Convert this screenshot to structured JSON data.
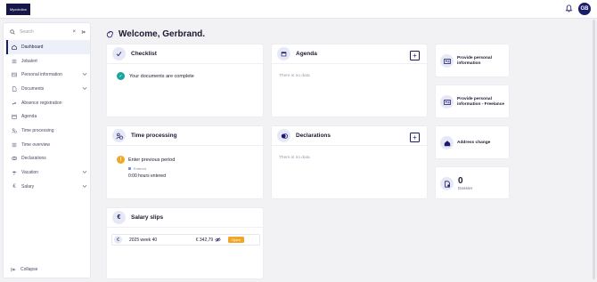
{
  "topbar": {
    "logo_text": "Myxolution",
    "avatar_initials": "GB"
  },
  "sidebar": {
    "search_placeholder": "Search",
    "items": [
      {
        "label": "Dashboard",
        "icon": "home-icon",
        "active": true
      },
      {
        "label": "Jobalert",
        "icon": "list-icon"
      },
      {
        "label": "Personal information",
        "icon": "id-card-icon",
        "expandable": true
      },
      {
        "label": "Documents",
        "icon": "document-icon",
        "expandable": true
      },
      {
        "label": "Absence registration",
        "icon": "plane-icon"
      },
      {
        "label": "Agenda",
        "icon": "calendar-icon"
      },
      {
        "label": "Time processing",
        "icon": "clock-user-icon"
      },
      {
        "label": "Time overview",
        "icon": "list-icon"
      },
      {
        "label": "Declarations",
        "icon": "coins-icon"
      },
      {
        "label": "Vacation",
        "icon": "umbrella-icon",
        "expandable": true
      },
      {
        "label": "Salary",
        "icon": "euro-icon",
        "expandable": true
      }
    ],
    "collapse_label": "Collapse"
  },
  "welcome": {
    "title": "Welcome, Gerbrand."
  },
  "checklist": {
    "title": "Checklist",
    "message": "Your documents are complete"
  },
  "agenda": {
    "title": "Agenda",
    "empty": "There is no data"
  },
  "time_processing": {
    "title": "Time processing",
    "entry_title": "Enter previous period",
    "status": "Entered",
    "hours": "0:00 hours entered"
  },
  "declarations": {
    "title": "Declarations",
    "empty": "There is no data"
  },
  "salary_slips": {
    "title": "Salary slips",
    "rows": [
      {
        "period": "2025 week 40",
        "amount": "€ 342,79",
        "badge": "Open"
      }
    ]
  },
  "quick_actions": [
    {
      "label": "Provide personal information",
      "icon": "id-card-icon"
    },
    {
      "label": "Provide personal information - Freelance",
      "icon": "id-card-icon"
    },
    {
      "label": "Address change",
      "icon": "home-icon"
    }
  ],
  "dossier": {
    "count": "0",
    "label": "Dossier",
    "icon": "document-user-icon"
  },
  "colors": {
    "primary": "#1b1b6e",
    "success": "#1aa59a",
    "warning": "#f1a626"
  }
}
